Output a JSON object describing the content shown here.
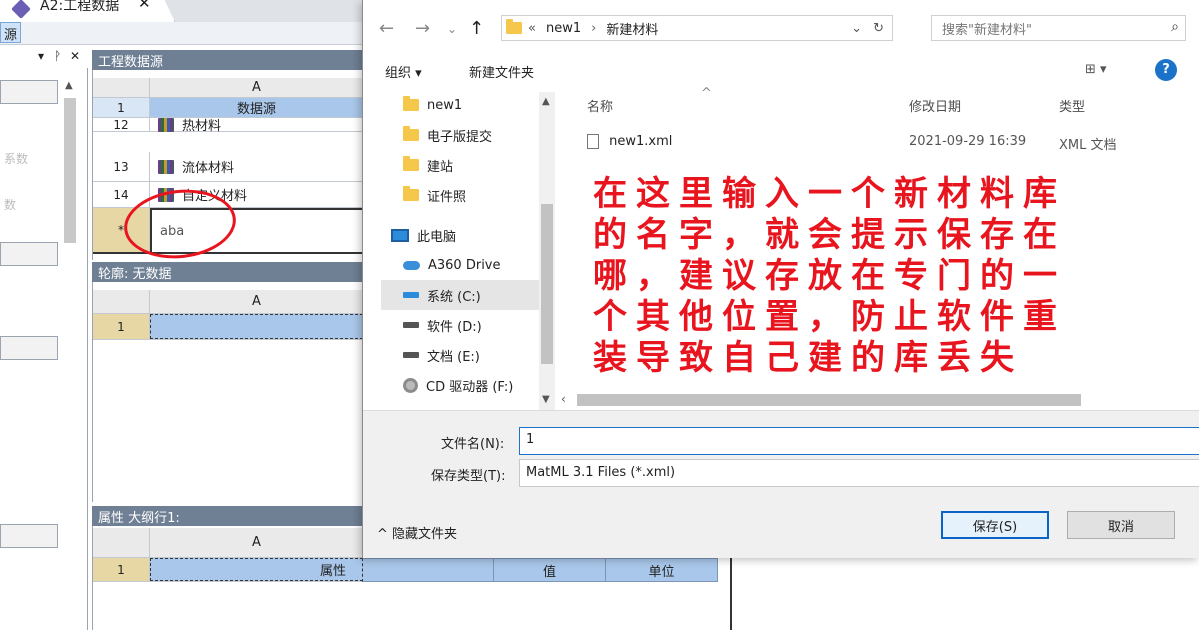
{
  "app": {
    "tab_title": "A2:工程数据",
    "tab_close": "✕",
    "source_toolbar_label": "源",
    "left_panel_header_glyphs": [
      "▾",
      "ᚹ",
      "✕"
    ],
    "left_panel_texts": [
      "系数",
      "数"
    ]
  },
  "engineering_source": {
    "panel_title": "工程数据源",
    "column_header": "A",
    "header_row_num": "1",
    "header_cell": "数据源",
    "rows": [
      {
        "num": "12",
        "label": "热材料"
      },
      {
        "num": "13",
        "label": "流体材料"
      },
      {
        "num": "14",
        "label": "自定义材料"
      }
    ],
    "new_row_marker": "*",
    "new_row_value": "aba"
  },
  "outline_panel": {
    "panel_title": "轮廓: 无数据",
    "column_header": "A",
    "row_num": "1"
  },
  "properties_panel": {
    "panel_title": "属性 大纲行1:",
    "column_header": "A",
    "row_num": "1",
    "col_property": "属性",
    "col_value": "值",
    "col_unit": "单位"
  },
  "dialog": {
    "nav": {
      "back": "←",
      "forward": "→",
      "dropdown": "⌄",
      "up": "↑"
    },
    "path": {
      "overflow": "«",
      "segments": [
        "new1",
        "新建材料"
      ],
      "separator": "›",
      "dropdown": "⌄",
      "refresh": "↻"
    },
    "search_placeholder": "搜索\"新建材料\"",
    "search_icon": "⌕",
    "organize_label": "组织 ▾",
    "new_folder_label": "新建文件夹",
    "view_icon": "⊞ ▾",
    "help_icon": "?",
    "nav_items": [
      {
        "label": "new1",
        "icon": "folder-icon"
      },
      {
        "label": "电子版提交",
        "icon": "folder-icon"
      },
      {
        "label": "建站",
        "icon": "folder-icon"
      },
      {
        "label": "证件照",
        "icon": "folder-icon"
      },
      {
        "label": "此电脑",
        "icon": "computer-icon"
      },
      {
        "label": "A360 Drive",
        "icon": "cloud-drive-icon"
      },
      {
        "label": "系统 (C:)",
        "icon": "drive-icon"
      },
      {
        "label": "软件 (D:)",
        "icon": "drive-icon"
      },
      {
        "label": "文档 (E:)",
        "icon": "drive-icon"
      },
      {
        "label": "CD 驱动器 (F:)",
        "icon": "cd-drive-icon"
      }
    ],
    "columns": {
      "name": "名称",
      "modified": "修改日期",
      "type": "类型"
    },
    "files": [
      {
        "name": "new1.xml",
        "modified": "2021-09-29 16:39",
        "type": "XML 文档"
      }
    ],
    "annotation": "在这里输入一个新材料库的名字，就会提示保存在哪，建议存放在专门的一个其他位置，防止软件重装导致自己建的库丢失",
    "filename_label": "文件名(N):",
    "filename_value": "1",
    "filetype_label": "保存类型(T):",
    "filetype_value": "MatML 3.1 Files (*.xml)",
    "hide_folders_label": "^ 隐藏文件夹",
    "save_button": "保存(S)",
    "cancel_button": "取消"
  }
}
